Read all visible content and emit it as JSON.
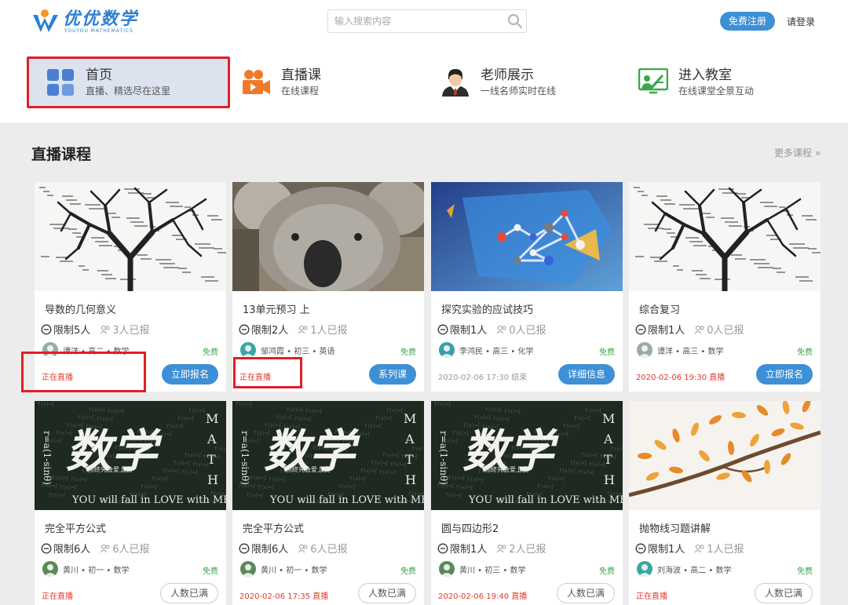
{
  "header": {
    "logo_cn": "优优数学",
    "logo_en": "YOUYOU MATHEMATICS",
    "search_placeholder": "输入搜索内容",
    "register_label": "免费注册",
    "login_label": "请登录"
  },
  "nav": [
    {
      "title": "首页",
      "sub": "直播、精选尽在这里",
      "icon": "grid-icon"
    },
    {
      "title": "直播课",
      "sub": "在线课程",
      "icon": "video-camera-icon"
    },
    {
      "title": "老师展示",
      "sub": "一线名师实时在线",
      "icon": "teacher-icon"
    },
    {
      "title": "进入教室",
      "sub": "在线课堂全景互动",
      "icon": "classroom-icon"
    }
  ],
  "section": {
    "title": "直播课程",
    "more": "更多课程 »"
  },
  "colors": {
    "accent": "#3d8fd6",
    "free": "#3aa84a",
    "live": "#e03b2a",
    "highlight": "#e21f26"
  },
  "courses": [
    {
      "title": "导数的几何意义",
      "limit": "限制5人",
      "signed": "3人已报",
      "teacher": "谭洋 • 高二 • 数学",
      "free": "免费",
      "status": "正在直播",
      "status_grey": "",
      "button": "立即报名",
      "thumb": "math-tree"
    },
    {
      "title": "13单元预习 上",
      "limit": "限制2人",
      "signed": "1人已报",
      "teacher": "邹鸿霞 • 初三 • 英语",
      "free": "免费",
      "status": "正在直播",
      "status_grey": "",
      "button": "系列课",
      "thumb": "koala"
    },
    {
      "title": "探究实验的应试技巧",
      "limit": "限制1人",
      "signed": "0人已报",
      "teacher": "李鸿民 • 高三 • 化学",
      "free": "免费",
      "status": "",
      "status_grey": "2020-02-06 17:30 结束",
      "button": "详细信息",
      "thumb": "molecule"
    },
    {
      "title": "综合复习",
      "limit": "限制1人",
      "signed": "0人已报",
      "teacher": "谭洋 • 高三 • 数学",
      "free": "免费",
      "status": "2020-02-06 19:30 直播",
      "status_grey": "",
      "button": "立即报名",
      "thumb": "math-tree"
    },
    {
      "title": "完全平方公式",
      "limit": "限制6人",
      "signed": "6人已报",
      "teacher": "黄川 • 初一 • 数学",
      "free": "免费",
      "status": "正在直播",
      "status_grey": "",
      "button": "人数已满",
      "thumb": "shuxue"
    },
    {
      "title": "完全平方公式",
      "limit": "限制6人",
      "signed": "6人已报",
      "teacher": "黄川 • 初一 • 数学",
      "free": "免费",
      "status": "2020-02-06 17:35 直播",
      "status_grey": "",
      "button": "人数已满",
      "thumb": "shuxue"
    },
    {
      "title": "圆与四边形2",
      "limit": "限制1人",
      "signed": "2人已报",
      "teacher": "黄川 • 初三 • 数学",
      "free": "免费",
      "status": "2020-02-06 19:40 直播",
      "status_grey": "",
      "button": "人数已满",
      "thumb": "shuxue"
    },
    {
      "title": "抛物线习题讲解",
      "limit": "限制1人",
      "signed": "1人已报",
      "teacher": "刘海波 • 高二 • 数学",
      "free": "免费",
      "status": "正在直播",
      "status_grey": "",
      "button": "人数已满",
      "thumb": "autumn-branch"
    }
  ],
  "shuxue_art": {
    "cn": "数学",
    "side": "MATH",
    "formula": "r=a(1-sinθ)",
    "tag": "你终究会爱上我",
    "en": "YOU will fall in LOVE with ME"
  }
}
